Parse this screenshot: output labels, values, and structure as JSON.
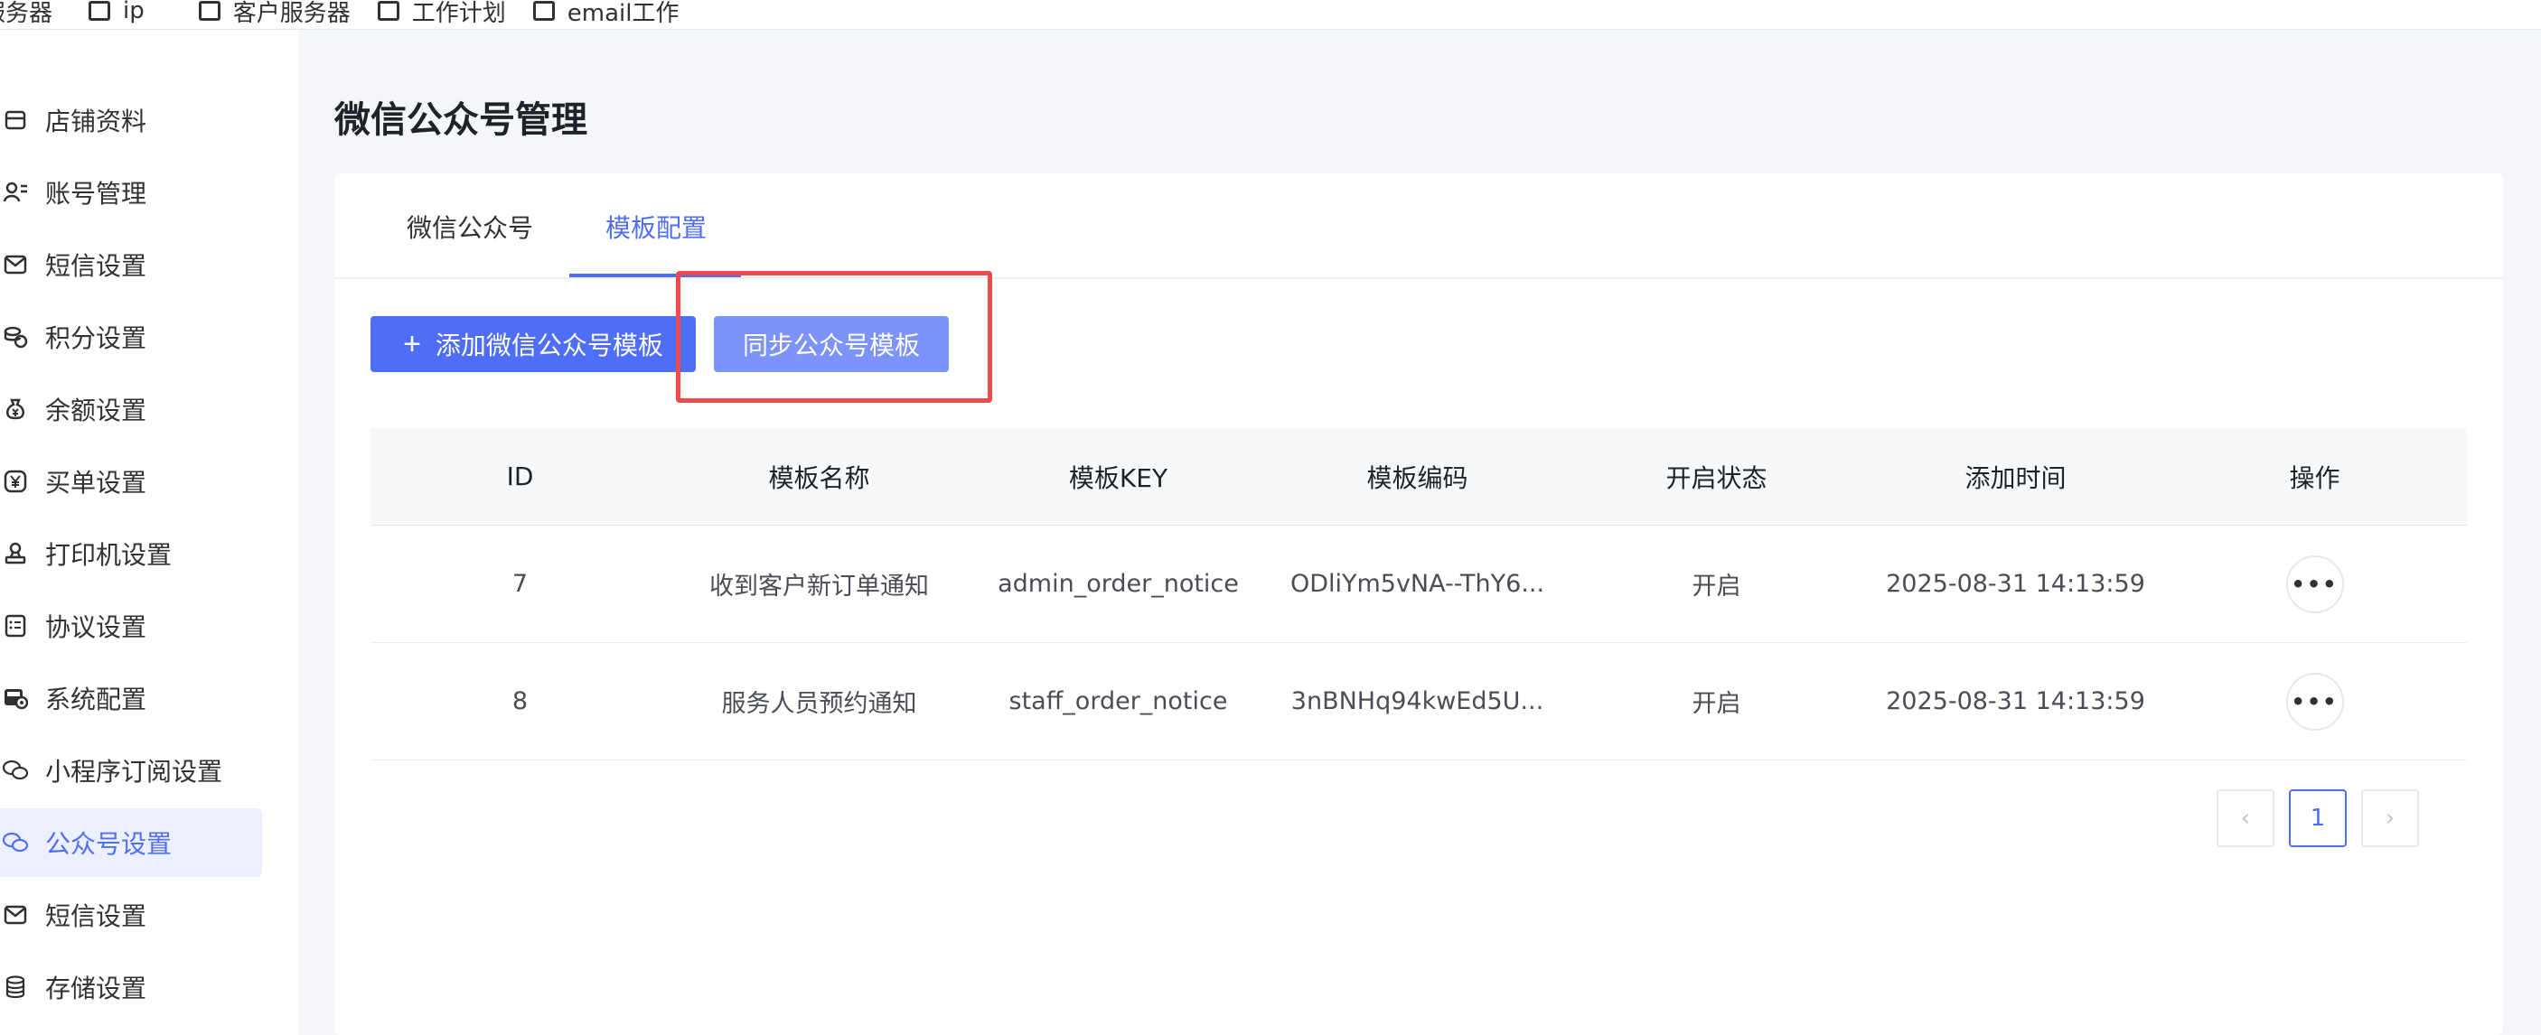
{
  "top_tabs": [
    "服务器",
    "ip",
    "客户服务器",
    "工作计划",
    "email工作"
  ],
  "sidebar": {
    "items": [
      {
        "label": "店铺资料",
        "icon": "store-icon"
      },
      {
        "label": "账号管理",
        "icon": "user-list-icon"
      },
      {
        "label": "短信设置",
        "icon": "mail-icon"
      },
      {
        "label": "积分设置",
        "icon": "coins-icon"
      },
      {
        "label": "余额设置",
        "icon": "money-bag-icon"
      },
      {
        "label": "买单设置",
        "icon": "yen-icon"
      },
      {
        "label": "打印机设置",
        "icon": "printer-icon"
      },
      {
        "label": "协议设置",
        "icon": "document-list-icon"
      },
      {
        "label": "系统配置",
        "icon": "system-icon"
      },
      {
        "label": "小程序订阅设置",
        "icon": "wechat-icon"
      },
      {
        "label": "公众号设置",
        "icon": "wechat-icon"
      },
      {
        "label": "短信设置",
        "icon": "mail-icon"
      },
      {
        "label": "存储设置",
        "icon": "database-icon"
      }
    ],
    "active_index": 10
  },
  "page": {
    "title": "微信公众号管理"
  },
  "tabs": [
    {
      "label": "微信公众号"
    },
    {
      "label": "模板配置"
    }
  ],
  "toolbar": {
    "add_label": "添加微信公众号模板",
    "sync_label": "同步公众号模板"
  },
  "table": {
    "headers": [
      "ID",
      "模板名称",
      "模板KEY",
      "模板编码",
      "开启状态",
      "添加时间",
      "操作"
    ],
    "rows": [
      {
        "id": "7",
        "name": "收到客户新订单通知",
        "key": "admin_order_notice",
        "code": "ODliYm5vNA--ThY6...",
        "status": "开启",
        "time": "2025-08-31 14:13:59",
        "action": "•••"
      },
      {
        "id": "8",
        "name": "服务人员预约通知",
        "key": "staff_order_notice",
        "code": "3nBNHq94kwEd5U...",
        "status": "开启",
        "time": "2025-08-31 14:13:59",
        "action": "•••"
      }
    ]
  },
  "pagination": {
    "prev": "‹",
    "current": "1",
    "next": "›"
  },
  "colors": {
    "accent": "#4f6ef7",
    "highlight": "#ef4b4b"
  }
}
